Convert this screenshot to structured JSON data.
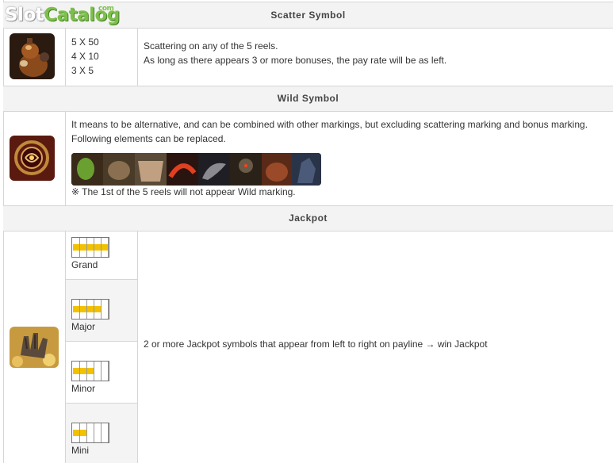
{
  "logo": {
    "part1": "Slot",
    "part2": "Catalog",
    "suffix": "com"
  },
  "scatter": {
    "header": "Scatter Symbol",
    "pays": [
      "5 X 50",
      "4 X 10",
      "3 X 5"
    ],
    "desc": [
      "Scattering on any of the 5 reels.",
      "As long as there appears 3 or more bonuses, the pay rate will be as left."
    ],
    "icon": "scatter-gourd-symbol"
  },
  "wild": {
    "header": "Wild Symbol",
    "desc": [
      "It means to be alternative, and can be combined with other markings, but excluding scattering marking and bonus marking.",
      "Following elements can be replaced."
    ],
    "note": "※ The 1st of the 5 reels will not appear Wild marking.",
    "icon": "wild-ring-symbol"
  },
  "jackpot": {
    "header": "Jackpot",
    "levels": [
      {
        "label": "Grand",
        "filled": 5
      },
      {
        "label": "Major",
        "filled": 4
      },
      {
        "label": "Minor",
        "filled": 3
      },
      {
        "label": "Mini",
        "filled": 2
      }
    ],
    "desc": "2 or more Jackpot symbols that appear from left to right on payline → win Jackpot",
    "icon": "jackpot-hand-symbol"
  },
  "colors": {
    "header_bg": "#f3f3f3",
    "border": "#d6d6d6",
    "jackpot_fill": "#f2c200",
    "logo_green": "#7cc04a"
  }
}
